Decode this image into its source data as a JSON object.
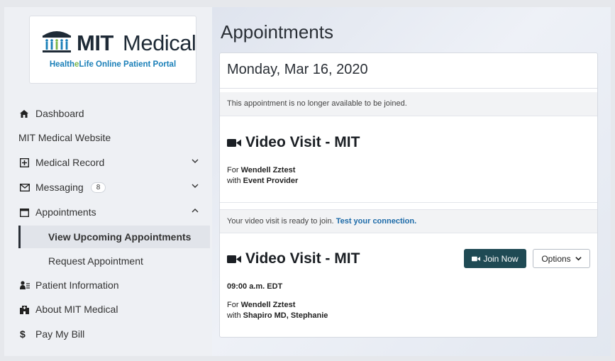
{
  "logo": {
    "brand_bold": "MIT",
    "brand_regular": "Medical",
    "subtitle_pre": "Health",
    "subtitle_e": "e",
    "subtitle_post": "Life Online Patient Portal"
  },
  "sidebar": {
    "dashboard": "Dashboard",
    "website": "MIT Medical Website",
    "medical_record": "Medical Record",
    "messaging": "Messaging",
    "messaging_badge": "8",
    "appointments": "Appointments",
    "view_upcoming": "View Upcoming Appointments",
    "request": "Request Appointment",
    "patient_info": "Patient Information",
    "about": "About MIT Medical",
    "pay": "Pay My Bill"
  },
  "main": {
    "title": "Appointments",
    "date": "Monday, Mar 16, 2020",
    "appt1": {
      "notice": "This appointment is no longer available to be joined.",
      "title": "Video Visit - MIT",
      "for_prefix": "For ",
      "patient": "Wendell Zztest",
      "with_prefix": "with ",
      "provider": "Event Provider"
    },
    "appt2": {
      "notice": "Your video visit is ready to join. ",
      "notice_link": "Test your connection.",
      "title": "Video Visit - MIT",
      "time": "09:00 a.m. EDT",
      "for_prefix": "For ",
      "patient": "Wendell Zztest",
      "with_prefix": "with ",
      "provider": "Shapiro MD, Stephanie",
      "join_label": "Join Now",
      "options_label": "Options"
    }
  },
  "colors": {
    "accent": "#1f4a54",
    "link": "#1c6aa8",
    "brand_blue": "#1a7fb8",
    "brand_green": "#7ab648"
  }
}
